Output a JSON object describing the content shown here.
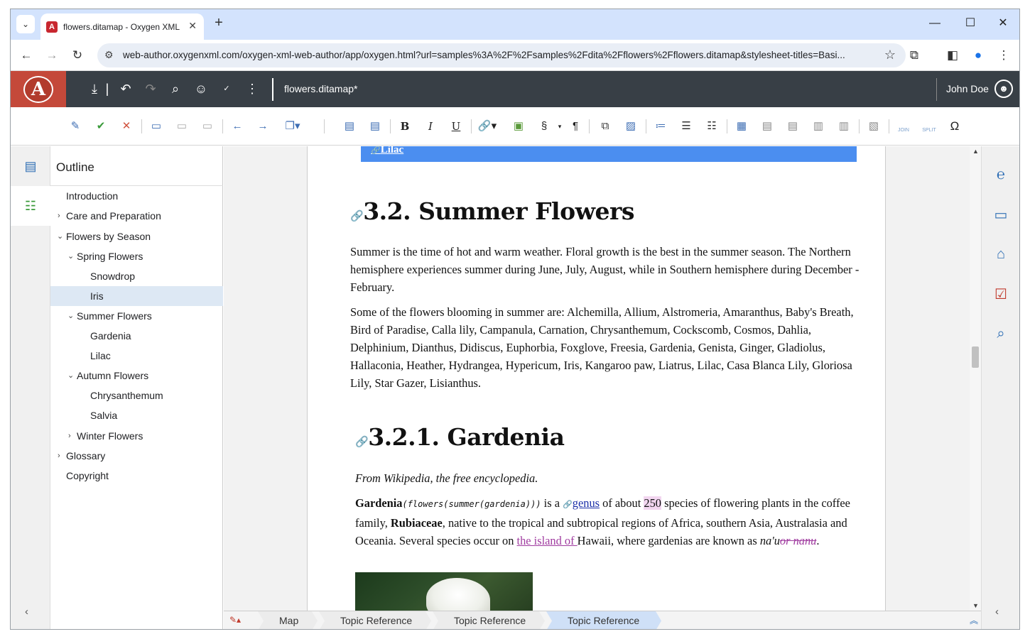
{
  "browser": {
    "tab_title": "flowers.ditamap - Oxygen XML",
    "url": "web-author.oxygenxml.com/oxygen-xml-web-author/app/oxygen.html?url=samples%3A%2F%2Fsamples%2Fdita%2Fflowers%2Fflowers.ditamap&stylesheet-titles=Basi..."
  },
  "app": {
    "doc_name": "flowers.ditamap*",
    "user_name": "John Doe",
    "brand_color": "#c4493a",
    "header_color": "#383f46"
  },
  "toolbar": {
    "bold": "B",
    "italic": "I",
    "underline": "U",
    "section": "§",
    "pilcrow": "¶",
    "join": "JOIN",
    "split": "SPLIT",
    "omega": "Ω"
  },
  "outline": {
    "title": "Outline",
    "items": [
      {
        "label": "Introduction"
      },
      {
        "label": "Care and Preparation"
      },
      {
        "label": "Flowers by Season"
      },
      {
        "label": "Spring Flowers"
      },
      {
        "label": "Snowdrop"
      },
      {
        "label": "Iris"
      },
      {
        "label": "Summer Flowers"
      },
      {
        "label": "Gardenia"
      },
      {
        "label": "Lilac"
      },
      {
        "label": "Autumn Flowers"
      },
      {
        "label": "Chrysanthemum"
      },
      {
        "label": "Salvia"
      },
      {
        "label": "Winter Flowers"
      },
      {
        "label": "Glossary"
      },
      {
        "label": "Copyright"
      }
    ]
  },
  "editor": {
    "lilac_link": "Lilac",
    "summer_heading": "3.2. Summer Flowers",
    "summer_p1": "Summer is the time of hot and warm weather. Floral growth is the best in the summer season. The Northern hemisphere experiences summer during June, July, August, while in Southern hemisphere during December - February.",
    "summer_p2": "Some of the flowers blooming in summer are: Alchemilla, Allium, Alstromeria, Amaranthus, Baby's Breath, Bird of Paradise, Calla lily, Campanula, Carnation, Chrysanthemum, Cockscomb, Cosmos, Dahlia, Delphinium, Dianthus, Didiscus, Euphorbia, Foxglove, Freesia, Gardenia, Genista, Ginger, Gladiolus, Hallaconia, Heather, Hydrangea, Hypericum, Iris, Kangaroo paw, Liatrus, Lilac, Casa Blanca Lily, Gloriosa Lily, Star Gazer, Lisianthus.",
    "gardenia_heading": "3.2.1. Gardenia",
    "wiki_line": "From Wikipedia, the free encyclopedia.",
    "g_term": "Gardenia",
    "g_code": "(flowers(summer(gardenia)))",
    "g_t1": " is a ",
    "g_genus": "genus",
    "g_t2": " of about ",
    "g_250": "250",
    "g_t3": " species of flowering plants in the coffee family, ",
    "g_rubi": "Rubiaceae",
    "g_t4": ", native to the tropical and subtropical regions of Africa, southern Asia, Australasia and Oceania. Several species occur on ",
    "g_island": "the island of ",
    "g_t5": "Hawaii, where gardenias are known as ",
    "g_naau": "na'u",
    "g_nanu": "or nanu",
    "g_t6": "."
  },
  "breadcrumb": [
    "Map",
    "Topic Reference",
    "Topic Reference",
    "Topic Reference"
  ]
}
